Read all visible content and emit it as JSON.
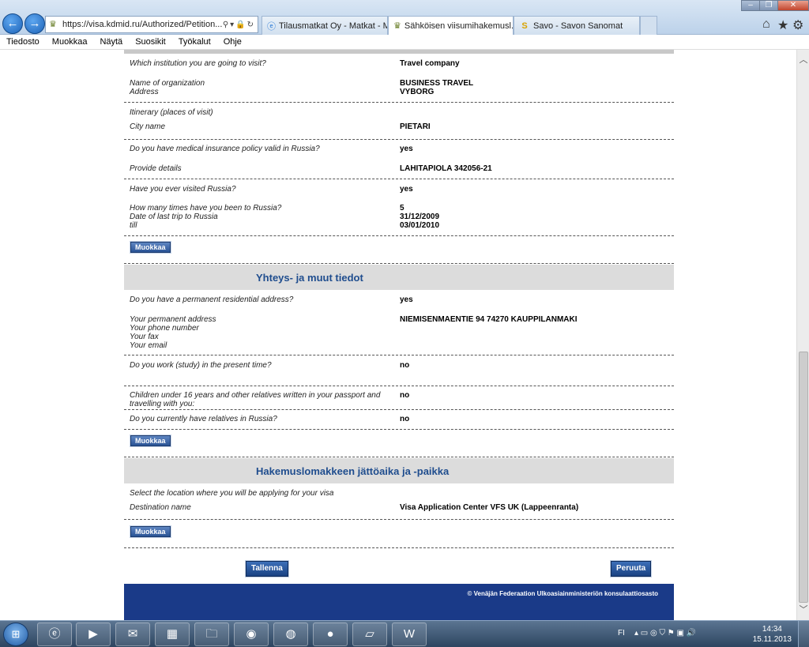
{
  "browser": {
    "url": "https://visa.kdmid.ru/Authorized/Petition...",
    "tabs": [
      {
        "label": "Tilausmatkat Oy - Matkat - Mo...",
        "icon": "ie-icon"
      },
      {
        "label": "Sähköisen viisumihakemusl...",
        "icon": "emblem-icon"
      },
      {
        "label": "Savo - Savon Sanomat",
        "icon": "savo-icon"
      }
    ]
  },
  "menubar": [
    "Tiedosto",
    "Muokkaa",
    "Näytä",
    "Suosikit",
    "Työkalut",
    "Ohje"
  ],
  "form": {
    "institution_q": "Which institution you are going to visit?",
    "institution_a": "Travel company",
    "org_name_q": "Name of organization",
    "org_name_a": "BUSINESS TRAVEL",
    "address_q": "Address",
    "address_a": "VYBORG",
    "itinerary_q": "Itinerary (places of visit)",
    "city_q": "City name",
    "city_a": "PIETARI",
    "insurance_q": "Do you have medical insurance policy valid in Russia?",
    "insurance_a": "yes",
    "details_q": "Provide details",
    "details_a": "LAHITAPIOLA 342056-21",
    "visited_q": "Have you ever visited Russia?",
    "visited_a": "yes",
    "times_q": "How many times have you been to Russia?",
    "times_a": "5",
    "last_trip_q": "Date of last trip to Russia",
    "last_trip_a": "31/12/2009",
    "till_q": "till",
    "till_a": "03/01/2010",
    "edit_label": "Muokkaa",
    "section2_title": "Yhteys- ja muut tiedot",
    "perm_addr_q": "Do you have a permanent residential address?",
    "perm_addr_a": "yes",
    "your_addr_q": "Your permanent address",
    "your_addr_a": "NIEMISENMAENTIE 94 74270 KAUPPILANMAKI",
    "phone_q": "Your phone number",
    "fax_q": "Your fax",
    "email_q": "Your email",
    "work_q": "Do you work (study) in the present time?",
    "work_a": "no",
    "children_q": "Children under 16 years and other relatives written in your passport and travelling with you:",
    "children_a": "no",
    "relatives_q": "Do you currently have relatives in Russia?",
    "relatives_a": "no",
    "section3_title": "Hakemuslomakkeen jättöaika ja -paikka",
    "location_q": "Select the location where you will be applying for your visa",
    "destination_q": "Destination name",
    "destination_a": "Visa Application Center VFS UK (Lappeenranta)",
    "save_label": "Tallenna",
    "cancel_label": "Peruuta",
    "footer": "© Venäjän Federaation Ulkoasiainministeriön konsulaattiosasto"
  },
  "taskbar": {
    "lang": "FI",
    "time": "14:34",
    "date": "15.11.2013"
  }
}
